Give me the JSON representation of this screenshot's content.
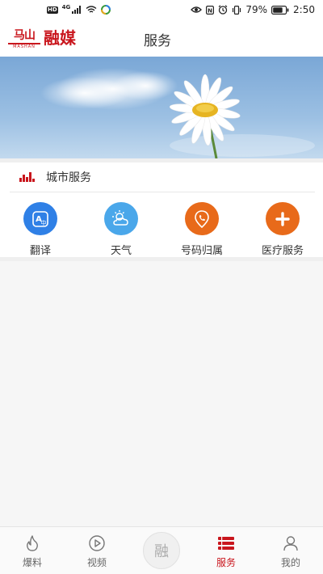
{
  "status_bar": {
    "hd": "HD",
    "network": "4G",
    "nfc": "N",
    "battery": "79%",
    "time": "2:50"
  },
  "header": {
    "logo_small": "马山",
    "logo_sub": "MASHAN",
    "logo_main": "融媒",
    "title": "服务"
  },
  "section": {
    "title": "城市服务"
  },
  "services": [
    {
      "label": "翻译",
      "icon": "translate-icon",
      "color": "#2f80e6"
    },
    {
      "label": "天气",
      "icon": "weather-icon",
      "color": "#4aa7ea"
    },
    {
      "label": "号码归属",
      "icon": "phone-location-icon",
      "color": "#e86a1a"
    },
    {
      "label": "医疗服务",
      "icon": "medical-plus-icon",
      "color": "#e86a1a"
    }
  ],
  "bottom_nav": {
    "items": [
      {
        "label": "爆料",
        "icon": "flame-icon",
        "active": false
      },
      {
        "label": "视频",
        "icon": "play-icon",
        "active": false
      },
      {
        "label": "融",
        "icon": "center-rong-button",
        "active": false
      },
      {
        "label": "服务",
        "icon": "service-list-icon",
        "active": true
      },
      {
        "label": "我的",
        "icon": "person-icon",
        "active": false
      }
    ]
  },
  "colors": {
    "brand": "#c9161d",
    "service_blue": "#2f80e6",
    "service_light_blue": "#4aa7ea",
    "service_orange": "#e86a1a"
  }
}
